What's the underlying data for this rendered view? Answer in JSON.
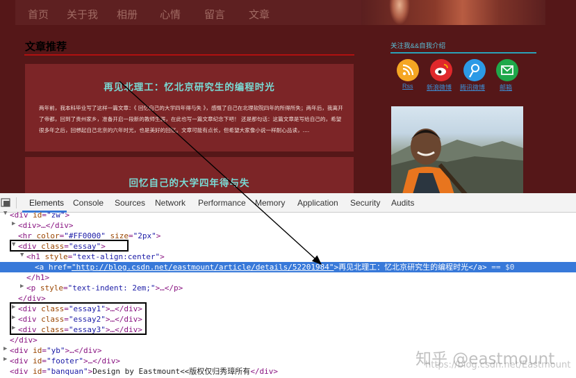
{
  "site": {
    "nav": [
      "首页",
      "关于我",
      "相册",
      "心情",
      "留言",
      "文章"
    ],
    "section_title": "文章推荐",
    "cards": [
      {
        "title": "再见北理工：忆北京研究生的编程时光",
        "text": "两年前，我本科毕业写了这样一篇文章：《 回忆自己的大学四年得与失 》，感慨了自己在北理软院四年的所得所失；两年后，我离开了帝都，回到了贵州家乡，准备开启一段新的教师生涯，在此也写一篇文章纪念下吧！ 还是那句话：这篇文章是写给自己的，希望很多年之后，回想起自己北京的六年时光，也是美好的回忆。文章可能有点长，但希望大家像小说一样耐心品读，...."
      },
      {
        "title": "回忆自己的大学四年得与失",
        "text": ""
      }
    ],
    "sidebar": {
      "title": "关注我&&自我介绍",
      "links": [
        "Rss",
        "新浪微博",
        "腾讯微博",
        "邮箱"
      ]
    }
  },
  "devtools": {
    "tabs": [
      "Elements",
      "Console",
      "Sources",
      "Network",
      "Performance",
      "Memory",
      "Application",
      "Security",
      "Audits"
    ],
    "lines": {
      "l0": {
        "tag_open": "<div ",
        "attr": "id",
        "val": "\"zw\"",
        "close": ">"
      },
      "l1": {
        "text": "<div>…</div>"
      },
      "l2": {
        "tag_open": "<hr ",
        "attr": "color",
        "val": "\"#FF0000\"",
        "attr2": "size",
        "val2": "\"2px\"",
        "close": ">"
      },
      "l3": {
        "tag_open": "<div ",
        "attr": "class",
        "val": "\"essay\"",
        "close": ">"
      },
      "l4": {
        "tag_open": "<h1 ",
        "attr": "style",
        "val": "\"text-align:center\"",
        "close": ">"
      },
      "l5": {
        "tag_open": "<a ",
        "attr": "href",
        "val": "\"http://blog.csdn.net/eastmount/article/details/52201984\"",
        "close": ">",
        "text": "再见北理工：忆北京研究生的编程时光",
        "end": "</a>",
        "suffix": " == $0"
      },
      "l6": {
        "text": "</h1>"
      },
      "l7": {
        "tag_open": "<p ",
        "attr": "style",
        "val": "\"text-indent: 2em;\"",
        "close": ">…</p>"
      },
      "l8": {
        "text": "</div>"
      },
      "l9": {
        "tag_open": "<div ",
        "attr": "class",
        "val": "\"essay1\"",
        "close": ">…</div>"
      },
      "l10": {
        "tag_open": "<div ",
        "attr": "class",
        "val": "\"essay2\"",
        "close": ">…</div>"
      },
      "l11": {
        "tag_open": "<div ",
        "attr": "class",
        "val": "\"essay3\"",
        "close": ">…</div>"
      },
      "l12": {
        "text": "</div>"
      },
      "l13": {
        "tag_open": "<div ",
        "attr": "id",
        "val": "\"yb\"",
        "close": ">…</div>"
      },
      "l14": {
        "tag_open": "<div ",
        "attr": "id",
        "val": "\"footer\"",
        "close": ">…</div>"
      },
      "l15": {
        "tag_open": "<div ",
        "attr": "id",
        "val": "\"banquan\"",
        "close": ">",
        "text": "Design by Eastmount<<版权仅归秀璋所有",
        "end": "</div>"
      }
    }
  },
  "watermark": {
    "main": "知乎 @eastmount",
    "sub": "https://blog.csdn.net/Eastmount"
  },
  "colors": {
    "site_bg": "#551718",
    "card_bg": "#7c2527",
    "title_teal": "#79dbd5",
    "highlight": "#3879d9",
    "arrow": "#000000"
  }
}
